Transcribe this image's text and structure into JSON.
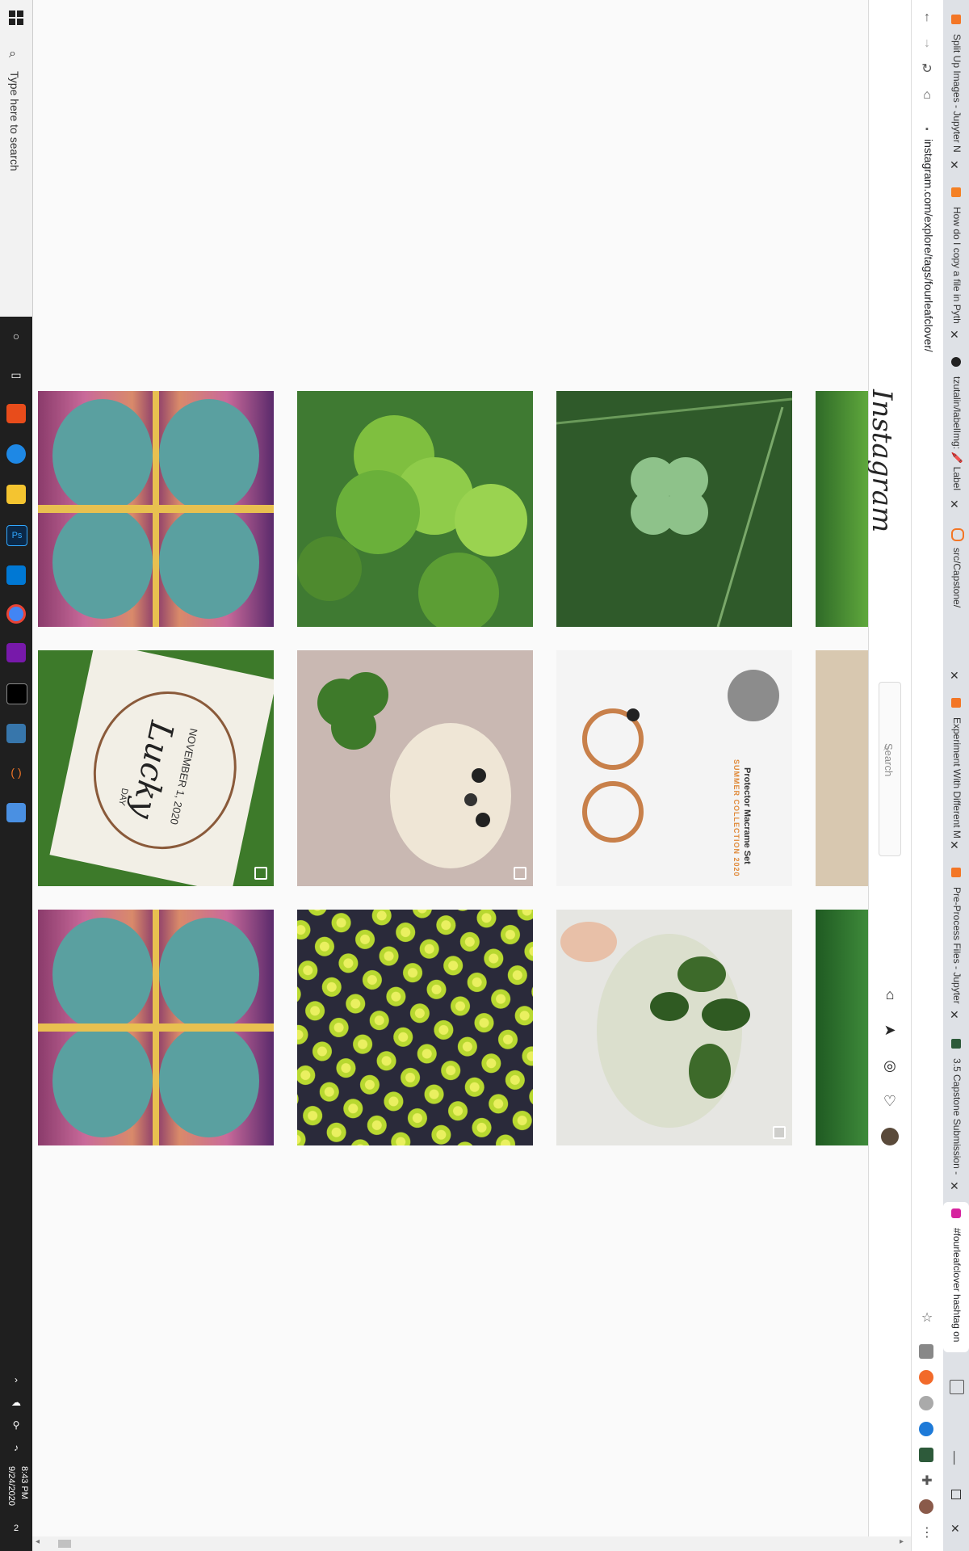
{
  "taskbar": {
    "search_placeholder": "Type here to search",
    "time": "8:43 PM",
    "date": "9/24/2020",
    "notification_count": "2"
  },
  "browser": {
    "url": "instagram.com/explore/tags/fourleafclover/",
    "tabs": [
      {
        "label": "Split Up Images - Jupyter N",
        "icon": "jupyter-icon"
      },
      {
        "label": "How do I copy a file in Pyth",
        "icon": "stackoverflow-icon"
      },
      {
        "label": "tzutalin/labelImg: 🖍️ Label",
        "icon": "github-icon"
      },
      {
        "label": "src/Capstone/",
        "icon": "jupyter-icon"
      },
      {
        "label": "Experiment With Different M",
        "icon": "jupyter-icon"
      },
      {
        "label": "Pre-Process Files - Jupyter",
        "icon": "jupyter-icon"
      },
      {
        "label": "3.5 Capstone Submission -",
        "icon": "springboard-icon"
      },
      {
        "label": "#fourleafclover hashtag on",
        "icon": "instagram-icon",
        "active": true
      }
    ]
  },
  "instagram": {
    "logo": "Instagram",
    "search_placeholder": "Search",
    "nav": [
      "home-icon",
      "direct-icon",
      "explore-icon",
      "activity-icon",
      "profile-avatar"
    ]
  },
  "posts": {
    "rows": [
      [
        {
          "subject": "tie-dye clover",
          "multi": false
        },
        {
          "subject": "clover leaves",
          "multi": false
        },
        {
          "subject": "four leaf clover in grass",
          "multi": false
        },
        {
          "subject": "green leaf partial",
          "multi": false
        }
      ],
      [
        {
          "subject": "lucky day sign",
          "multi": true,
          "sign_text": "Lucky",
          "sign_date": "NOVEMBER 1, 2020",
          "sign_day": "DAY"
        },
        {
          "subject": "dog with clover",
          "multi": true
        },
        {
          "subject": "macrame bracelet",
          "multi": false,
          "caption1": "Protector Macrame Set",
          "caption2": "SUMMER COLLECTION 2020"
        },
        {
          "subject": "sand partial",
          "multi": false
        }
      ],
      [
        {
          "subject": "tie-dye clover",
          "multi": false
        },
        {
          "subject": "clover pattern",
          "multi": false
        },
        {
          "subject": "plant in jar",
          "multi": true
        },
        {
          "subject": "grass partial",
          "multi": false
        }
      ]
    ]
  }
}
